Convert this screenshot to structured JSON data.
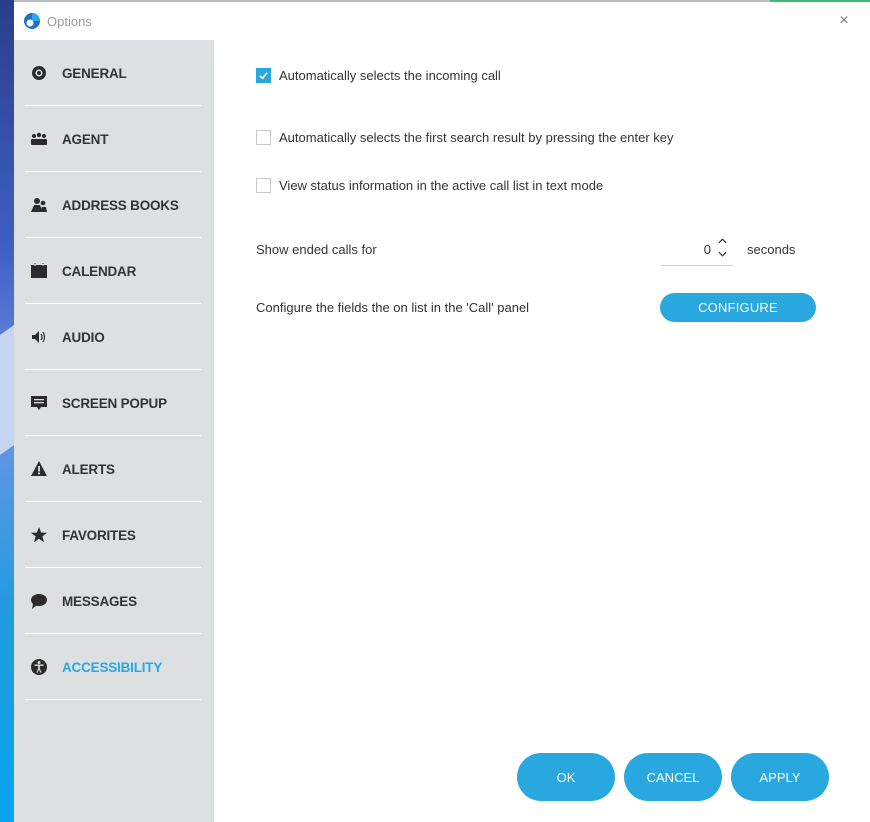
{
  "window": {
    "title": "Options",
    "close_glyph": "×"
  },
  "sidebar": {
    "items": [
      {
        "label": "GENERAL",
        "icon": "webcam-icon"
      },
      {
        "label": "AGENT",
        "icon": "agent-group-icon"
      },
      {
        "label": "ADDRESS BOOKS",
        "icon": "contacts-icon"
      },
      {
        "label": "CALENDAR",
        "icon": "calendar-icon"
      },
      {
        "label": "AUDIO",
        "icon": "speaker-icon"
      },
      {
        "label": "SCREEN POPUP",
        "icon": "monitor-icon"
      },
      {
        "label": "ALERTS",
        "icon": "warning-icon"
      },
      {
        "label": "FAVORITES",
        "icon": "star-icon"
      },
      {
        "label": "MESSAGES",
        "icon": "chat-bubble-icon"
      },
      {
        "label": "ACCESSIBILITY",
        "icon": "accessibility-icon",
        "active": true
      }
    ]
  },
  "settings": {
    "auto_select_incoming": {
      "label": "Automatically selects the incoming call",
      "checked": true
    },
    "auto_select_first_result": {
      "label": "Automatically selects the first search result by pressing the enter key",
      "checked": false
    },
    "status_text_mode": {
      "label": "View status information in the active call list in text mode",
      "checked": false
    },
    "ended_calls": {
      "label": "Show ended calls for",
      "value": "0",
      "unit": "seconds"
    },
    "configure_fields": {
      "label": "Configure the fields the on list in the 'Call' panel",
      "button": "CONFIGURE"
    }
  },
  "footer": {
    "ok": "OK",
    "cancel": "CANCEL",
    "apply": "APPLY"
  },
  "colors": {
    "accent": "#29a8e0",
    "sidebar_bg": "#dde0e1"
  }
}
